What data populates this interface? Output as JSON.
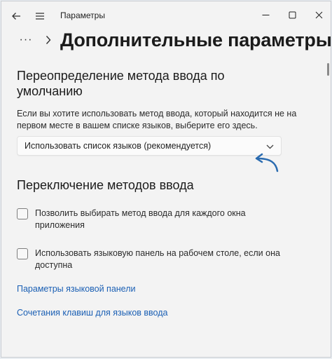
{
  "titlebar": {
    "title": "Параметры",
    "back_icon": "back-arrow-icon",
    "menu_icon": "hamburger-menu-icon",
    "minimize_icon": "minimize-icon",
    "maximize_icon": "maximize-icon",
    "close_icon": "close-icon"
  },
  "header": {
    "more_label": "···",
    "page_title": "Дополнительные параметры клави"
  },
  "section_default_input": {
    "title_line1": "Переопределение метода ввода по",
    "title_line2": "умолчанию",
    "description": "Если вы хотите использовать метод ввода, который находится не на первом месте в вашем списке языков, выберите его здесь.",
    "dropdown_value": "Использовать список языков (рекомендуется)"
  },
  "section_switching": {
    "title": "Переключение методов ввода",
    "checkboxes": [
      {
        "label": "Позволить выбирать метод ввода для каждого окна приложения",
        "checked": false
      },
      {
        "label": "Использовать языковую панель на рабочем столе, если она доступна",
        "checked": false
      }
    ]
  },
  "links": {
    "language_bar_options": "Параметры языковой панели",
    "input_hotkeys": "Сочетания клавиш для языков ввода"
  },
  "colors": {
    "window_bg": "#f3f3f3",
    "link": "#1a5fb4",
    "annotation_arrow": "#2a6bb0"
  }
}
